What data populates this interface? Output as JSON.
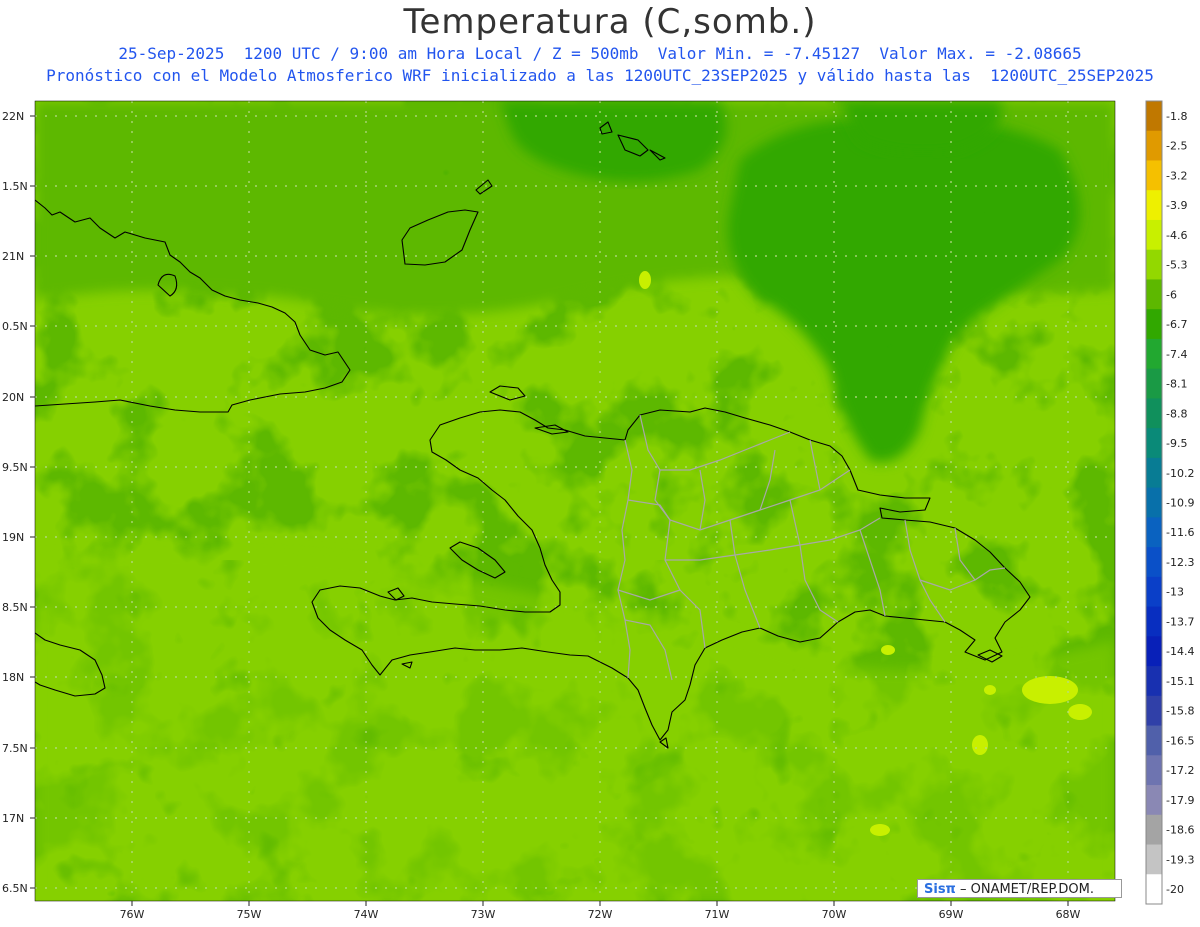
{
  "title": "Temperatura (C,somb.)",
  "subtitle_line1": "25-Sep-2025  1200 UTC / 9:00 am Hora Local / Z = 500mb  Valor Min. = -7.45127  Valor Max. = -2.08665",
  "subtitle_line2": "Pronóstico con el Modelo Atmosferico WRF inicializado a las 1200UTC_23SEP2025 y válido hasta las  1200UTC_25SEP2025",
  "logo": {
    "brand": "Sisπ",
    "text": " – ONAMET/REP.DOM."
  },
  "chart_data": {
    "type": "heatmap",
    "title": "Temperatura (C,somb.)",
    "xlabel": "",
    "ylabel": "",
    "x_ticks": [
      "76W",
      "75W",
      "74W",
      "73W",
      "72W",
      "71W",
      "70W",
      "69W",
      "68W"
    ],
    "y_ticks": [
      "22N",
      "1.5N",
      "21N",
      "0.5N",
      "20N",
      "9.5N",
      "19N",
      "8.5N",
      "18N",
      "7.5N",
      "17N",
      "6.5N"
    ],
    "lon_range": [
      -76.65,
      -67.65
    ],
    "lat_range": [
      16.45,
      22.1
    ],
    "value_min": -7.45127,
    "value_max": -2.08665,
    "colorbar_labels": [
      "-1.8",
      "-2.5",
      "-3.2",
      "-3.9",
      "-4.6",
      "-5.3",
      "-6",
      "-6.7",
      "-7.4",
      "-8.1",
      "-8.8",
      "-9.5",
      "-10.2",
      "-10.9",
      "-11.6",
      "-12.3",
      "-13",
      "-13.7",
      "-14.4",
      "-15.1",
      "-15.8",
      "-16.5",
      "-17.2",
      "-17.9",
      "-18.6",
      "-19.3",
      "-20"
    ],
    "colorbar_colors": [
      "#c07800",
      "#e09a00",
      "#f5c000",
      "#eef000",
      "#c8f000",
      "#93d800",
      "#5db800",
      "#31a800",
      "#22a830",
      "#1a9a45",
      "#10905c",
      "#0a8a78",
      "#087c94",
      "#0870aa",
      "#0a62c0",
      "#0a50c8",
      "#0a3fc8",
      "#082ec0",
      "#0820b8",
      "#1830b0",
      "#3040a8",
      "#5060aa",
      "#6e74b0",
      "#8a88b4",
      "#a4a4a4",
      "#c4c4c4",
      "#ffffff"
    ]
  }
}
